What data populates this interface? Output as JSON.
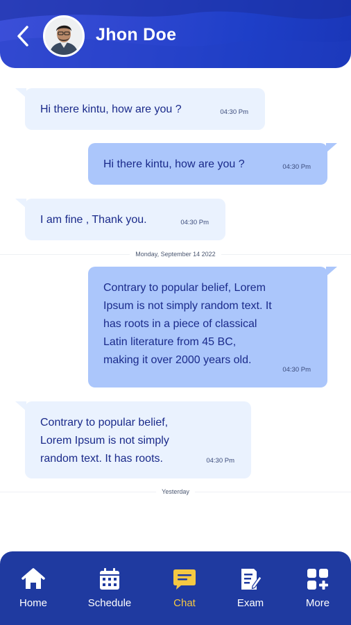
{
  "header": {
    "name": "Jhon Doe",
    "colors": {
      "gradient_start": "#3b4fd8",
      "gradient_end": "#1a36b8"
    }
  },
  "messages": [
    {
      "direction": "received",
      "text": "Hi there kintu, how are you ?",
      "time": "04:30 Pm"
    },
    {
      "direction": "sent",
      "text": "Hi there kintu, how are you ?",
      "time": "04:30 Pm"
    },
    {
      "direction": "received",
      "text": "I am fine , Thank you.",
      "time": "04:30 Pm"
    },
    {
      "direction": "sent",
      "text": "Contrary to popular belief, Lorem Ipsum is not simply random text. It has roots in a piece of classical Latin literature from 45 BC, making it over 2000 years old.",
      "time": "04:30 Pm"
    },
    {
      "direction": "received",
      "text": "Contrary to popular belief, Lorem Ipsum is not simply random text. It has roots.",
      "time": "04:30 Pm"
    }
  ],
  "dividers": [
    "Monday, September 14 2022",
    "Yesterday"
  ],
  "nav": {
    "active": "Chat",
    "items": [
      {
        "label": "Home",
        "icon": "home-icon"
      },
      {
        "label": "Schedule",
        "icon": "calendar-icon"
      },
      {
        "label": "Chat",
        "icon": "chat-icon"
      },
      {
        "label": "Exam",
        "icon": "exam-icon"
      },
      {
        "label": "More",
        "icon": "grid-plus-icon"
      }
    ],
    "colors": {
      "background": "#1f3aa0",
      "active": "#f5c842",
      "inactive": "#ffffff"
    }
  },
  "bubble_colors": {
    "received": "#eaf2fe",
    "sent": "#abc6fb",
    "text": "#1a2a8a"
  }
}
